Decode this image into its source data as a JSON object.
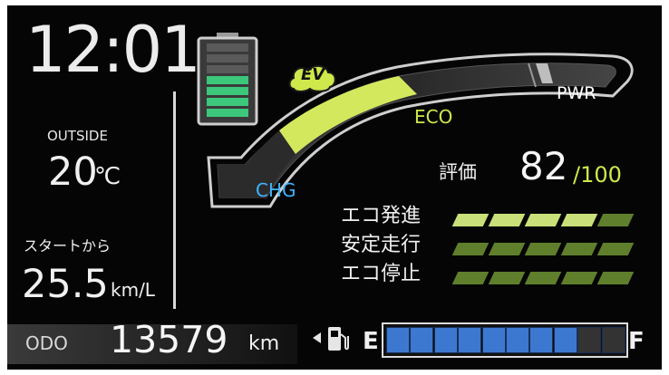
{
  "clock": "12:01",
  "outside": {
    "label": "OUTSIDE",
    "value": "20",
    "unit": "℃"
  },
  "economy": {
    "label": "スタートから",
    "value": "25.5",
    "unit": "km/L"
  },
  "odo": {
    "label": "ODO",
    "value": "13579",
    "unit": "km"
  },
  "hybrid_indicator": {
    "ev_label": "EV",
    "eco_label": "ECO",
    "pwr_label": "PWR",
    "chg_label": "CHG",
    "battery_level_segments": 4,
    "battery_total_segments": 7
  },
  "eco_score": {
    "label": "評価",
    "value": "82",
    "max": "/100",
    "rows": [
      {
        "label": "エコ発進",
        "filled": 4,
        "total": 5
      },
      {
        "label": "安定走行",
        "filled": 0,
        "total": 5
      },
      {
        "label": "エコ停止",
        "filled": 0,
        "total": 5
      }
    ]
  },
  "fuel": {
    "empty_label": "E",
    "full_label": "F",
    "filled_segments": 8,
    "total_segments": 10
  },
  "colors": {
    "background": "#050505",
    "eco_green": "#cfe84b",
    "chg_blue": "#3fb4ff",
    "segment_lit": "#c9e07a",
    "segment_dim": "#5f7f2c",
    "fuel_blue": "#3d78d0",
    "battery_green": "#3cc77a"
  }
}
